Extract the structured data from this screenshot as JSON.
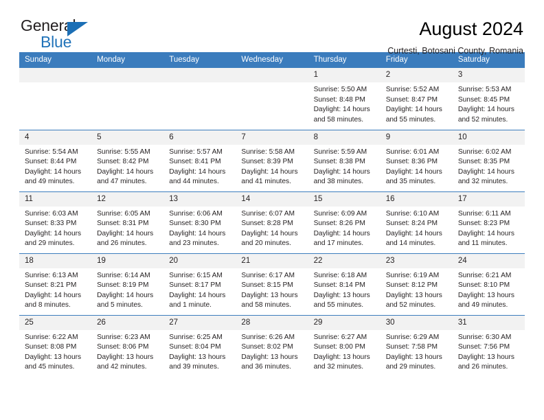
{
  "logo": {
    "line1": "General",
    "line2": "Blue",
    "triangle_color": "#1c6fb5",
    "text_color": "#231f20",
    "blue_text_color": "#2173b9"
  },
  "header": {
    "title": "August 2024",
    "subtitle": "Curtesti, Botosani County, Romania"
  },
  "calendar": {
    "header_bg": "#3b7cbd",
    "header_text": "#ffffff",
    "daynum_bg": "#f2f2f2",
    "weekdays": [
      "Sunday",
      "Monday",
      "Tuesday",
      "Wednesday",
      "Thursday",
      "Friday",
      "Saturday"
    ],
    "weeks": [
      [
        {
          "day": "",
          "sunrise": "",
          "sunset": "",
          "daylight1": "",
          "daylight2": ""
        },
        {
          "day": "",
          "sunrise": "",
          "sunset": "",
          "daylight1": "",
          "daylight2": ""
        },
        {
          "day": "",
          "sunrise": "",
          "sunset": "",
          "daylight1": "",
          "daylight2": ""
        },
        {
          "day": "",
          "sunrise": "",
          "sunset": "",
          "daylight1": "",
          "daylight2": ""
        },
        {
          "day": "1",
          "sunrise": "Sunrise: 5:50 AM",
          "sunset": "Sunset: 8:48 PM",
          "daylight1": "Daylight: 14 hours",
          "daylight2": "and 58 minutes."
        },
        {
          "day": "2",
          "sunrise": "Sunrise: 5:52 AM",
          "sunset": "Sunset: 8:47 PM",
          "daylight1": "Daylight: 14 hours",
          "daylight2": "and 55 minutes."
        },
        {
          "day": "3",
          "sunrise": "Sunrise: 5:53 AM",
          "sunset": "Sunset: 8:45 PM",
          "daylight1": "Daylight: 14 hours",
          "daylight2": "and 52 minutes."
        }
      ],
      [
        {
          "day": "4",
          "sunrise": "Sunrise: 5:54 AM",
          "sunset": "Sunset: 8:44 PM",
          "daylight1": "Daylight: 14 hours",
          "daylight2": "and 49 minutes."
        },
        {
          "day": "5",
          "sunrise": "Sunrise: 5:55 AM",
          "sunset": "Sunset: 8:42 PM",
          "daylight1": "Daylight: 14 hours",
          "daylight2": "and 47 minutes."
        },
        {
          "day": "6",
          "sunrise": "Sunrise: 5:57 AM",
          "sunset": "Sunset: 8:41 PM",
          "daylight1": "Daylight: 14 hours",
          "daylight2": "and 44 minutes."
        },
        {
          "day": "7",
          "sunrise": "Sunrise: 5:58 AM",
          "sunset": "Sunset: 8:39 PM",
          "daylight1": "Daylight: 14 hours",
          "daylight2": "and 41 minutes."
        },
        {
          "day": "8",
          "sunrise": "Sunrise: 5:59 AM",
          "sunset": "Sunset: 8:38 PM",
          "daylight1": "Daylight: 14 hours",
          "daylight2": "and 38 minutes."
        },
        {
          "day": "9",
          "sunrise": "Sunrise: 6:01 AM",
          "sunset": "Sunset: 8:36 PM",
          "daylight1": "Daylight: 14 hours",
          "daylight2": "and 35 minutes."
        },
        {
          "day": "10",
          "sunrise": "Sunrise: 6:02 AM",
          "sunset": "Sunset: 8:35 PM",
          "daylight1": "Daylight: 14 hours",
          "daylight2": "and 32 minutes."
        }
      ],
      [
        {
          "day": "11",
          "sunrise": "Sunrise: 6:03 AM",
          "sunset": "Sunset: 8:33 PM",
          "daylight1": "Daylight: 14 hours",
          "daylight2": "and 29 minutes."
        },
        {
          "day": "12",
          "sunrise": "Sunrise: 6:05 AM",
          "sunset": "Sunset: 8:31 PM",
          "daylight1": "Daylight: 14 hours",
          "daylight2": "and 26 minutes."
        },
        {
          "day": "13",
          "sunrise": "Sunrise: 6:06 AM",
          "sunset": "Sunset: 8:30 PM",
          "daylight1": "Daylight: 14 hours",
          "daylight2": "and 23 minutes."
        },
        {
          "day": "14",
          "sunrise": "Sunrise: 6:07 AM",
          "sunset": "Sunset: 8:28 PM",
          "daylight1": "Daylight: 14 hours",
          "daylight2": "and 20 minutes."
        },
        {
          "day": "15",
          "sunrise": "Sunrise: 6:09 AM",
          "sunset": "Sunset: 8:26 PM",
          "daylight1": "Daylight: 14 hours",
          "daylight2": "and 17 minutes."
        },
        {
          "day": "16",
          "sunrise": "Sunrise: 6:10 AM",
          "sunset": "Sunset: 8:24 PM",
          "daylight1": "Daylight: 14 hours",
          "daylight2": "and 14 minutes."
        },
        {
          "day": "17",
          "sunrise": "Sunrise: 6:11 AM",
          "sunset": "Sunset: 8:23 PM",
          "daylight1": "Daylight: 14 hours",
          "daylight2": "and 11 minutes."
        }
      ],
      [
        {
          "day": "18",
          "sunrise": "Sunrise: 6:13 AM",
          "sunset": "Sunset: 8:21 PM",
          "daylight1": "Daylight: 14 hours",
          "daylight2": "and 8 minutes."
        },
        {
          "day": "19",
          "sunrise": "Sunrise: 6:14 AM",
          "sunset": "Sunset: 8:19 PM",
          "daylight1": "Daylight: 14 hours",
          "daylight2": "and 5 minutes."
        },
        {
          "day": "20",
          "sunrise": "Sunrise: 6:15 AM",
          "sunset": "Sunset: 8:17 PM",
          "daylight1": "Daylight: 14 hours",
          "daylight2": "and 1 minute."
        },
        {
          "day": "21",
          "sunrise": "Sunrise: 6:17 AM",
          "sunset": "Sunset: 8:15 PM",
          "daylight1": "Daylight: 13 hours",
          "daylight2": "and 58 minutes."
        },
        {
          "day": "22",
          "sunrise": "Sunrise: 6:18 AM",
          "sunset": "Sunset: 8:14 PM",
          "daylight1": "Daylight: 13 hours",
          "daylight2": "and 55 minutes."
        },
        {
          "day": "23",
          "sunrise": "Sunrise: 6:19 AM",
          "sunset": "Sunset: 8:12 PM",
          "daylight1": "Daylight: 13 hours",
          "daylight2": "and 52 minutes."
        },
        {
          "day": "24",
          "sunrise": "Sunrise: 6:21 AM",
          "sunset": "Sunset: 8:10 PM",
          "daylight1": "Daylight: 13 hours",
          "daylight2": "and 49 minutes."
        }
      ],
      [
        {
          "day": "25",
          "sunrise": "Sunrise: 6:22 AM",
          "sunset": "Sunset: 8:08 PM",
          "daylight1": "Daylight: 13 hours",
          "daylight2": "and 45 minutes."
        },
        {
          "day": "26",
          "sunrise": "Sunrise: 6:23 AM",
          "sunset": "Sunset: 8:06 PM",
          "daylight1": "Daylight: 13 hours",
          "daylight2": "and 42 minutes."
        },
        {
          "day": "27",
          "sunrise": "Sunrise: 6:25 AM",
          "sunset": "Sunset: 8:04 PM",
          "daylight1": "Daylight: 13 hours",
          "daylight2": "and 39 minutes."
        },
        {
          "day": "28",
          "sunrise": "Sunrise: 6:26 AM",
          "sunset": "Sunset: 8:02 PM",
          "daylight1": "Daylight: 13 hours",
          "daylight2": "and 36 minutes."
        },
        {
          "day": "29",
          "sunrise": "Sunrise: 6:27 AM",
          "sunset": "Sunset: 8:00 PM",
          "daylight1": "Daylight: 13 hours",
          "daylight2": "and 32 minutes."
        },
        {
          "day": "30",
          "sunrise": "Sunrise: 6:29 AM",
          "sunset": "Sunset: 7:58 PM",
          "daylight1": "Daylight: 13 hours",
          "daylight2": "and 29 minutes."
        },
        {
          "day": "31",
          "sunrise": "Sunrise: 6:30 AM",
          "sunset": "Sunset: 7:56 PM",
          "daylight1": "Daylight: 13 hours",
          "daylight2": "and 26 minutes."
        }
      ]
    ]
  }
}
